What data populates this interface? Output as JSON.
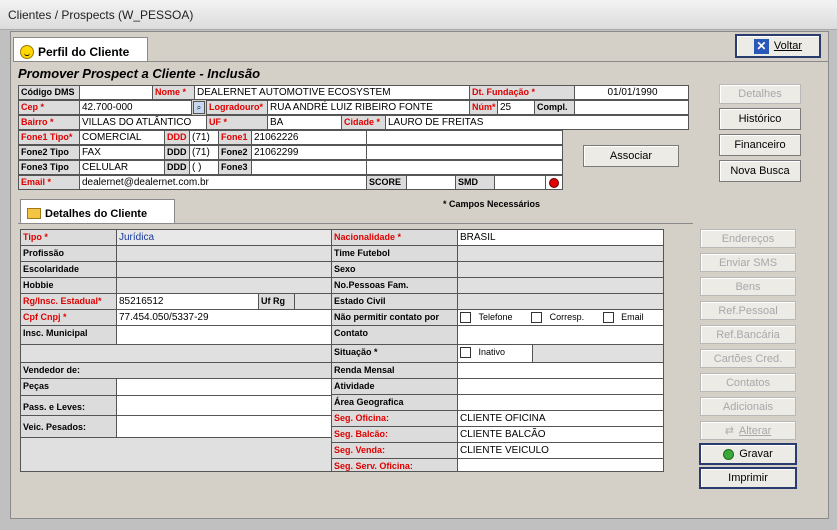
{
  "window": {
    "title": "Clientes / Prospects (W_PESSOA)"
  },
  "tabs": {
    "perfil": "Perfil do Cliente",
    "detalhes": "Detalhes do Cliente"
  },
  "form": {
    "heading": "Promover Prospect a Cliente - Inclusão",
    "required_note": "* Campos Necessários"
  },
  "buttons": {
    "voltar": "Voltar",
    "detalhes": "Detalhes",
    "historico": "Histórico",
    "financeiro": "Financeiro",
    "nova_busca": "Nova Busca",
    "associar": "Associar",
    "enderecos": "Endereços",
    "enviar_sms": "Enviar SMS",
    "bens": "Bens",
    "ref_pessoal": "Ref.Pessoal",
    "ref_bancaria": "Ref.Bancária",
    "cartoes": "Cartões Cred.",
    "contatos": "Contatos",
    "adicionais": "Adicionais",
    "alterar": "Alterar",
    "gravar": "Gravar",
    "imprimir": "Imprimir"
  },
  "header_fields": {
    "codigo_dms_label": "Código DMS",
    "codigo_dms": "",
    "nome_label": "Nome *",
    "nome": "DEALERNET AUTOMOTIVE ECOSYSTEM",
    "dt_fundacao_label": "Dt. Fundação *",
    "dt_fundacao": "01/01/1990",
    "cep_label": "Cep *",
    "cep": "42.700-000",
    "logradouro_label": "Logradouro*",
    "logradouro": "RUA ANDRÉ LUIZ RIBEIRO FONTE",
    "num_label": "Núm*",
    "num": "25",
    "compl_label": "Compl.",
    "compl": "",
    "bairro_label": "Bairro *",
    "bairro": "VILLAS DO ATLÂNTICO",
    "uf_label": "UF *",
    "uf": "BA",
    "cidade_label": "Cidade *",
    "cidade": "LAURO DE FREITAS",
    "fone1_tipo_label": "Fone1 Tipo*",
    "fone1_tipo": "COMERCIAL",
    "ddd1_label": "DDD",
    "ddd1": "(71)",
    "fone1_label": "Fone1",
    "fone1": "21062226",
    "fone2_tipo_label": "Fone2 Tipo",
    "fone2_tipo": "FAX",
    "ddd2_label": "DDD",
    "ddd2": "(71)",
    "fone2_label": "Fone2",
    "fone2": "21062299",
    "fone3_tipo_label": "Fone3 Tipo",
    "fone3_tipo": "CELULAR",
    "ddd3_label": "DDD",
    "ddd3": "(  )",
    "fone3_label": "Fone3",
    "fone3": "",
    "email_label": "Email *",
    "email": "dealernet@dealernet.com.br",
    "score_label": "SCORE",
    "score": "",
    "smd_label": "SMD",
    "smd": ""
  },
  "details_left": {
    "tipo_label": "Tipo *",
    "tipo": "Jurídica",
    "profissao_label": "Profissão",
    "escolaridade_label": "Escolaridade",
    "hobbie_label": "Hobbie",
    "rg_label": "Rg/Insc. Estadual*",
    "rg": "85216512",
    "uf_rg_label": "Uf Rg",
    "uf_rg": "",
    "cpf_label": "Cpf Cnpj *",
    "cpf": "77.454.050/5337-29",
    "insc_municipal_label": "Insc. Municipal",
    "insc_municipal": "",
    "vendedor_label": "Vendedor de:",
    "pecas_label": "Peças",
    "pass_leves_label": "Pass. e Leves:",
    "veic_pesados_label": "Veic. Pesados:"
  },
  "details_right": {
    "nacionalidade_label": "Nacionalidade *",
    "nacionalidade": "BRASIL",
    "time_label": "Time Futebol",
    "sexo_label": "Sexo",
    "no_pessoas_label": "No.Pessoas Fam.",
    "estado_civil_label": "Estado Civil",
    "nao_permitir_label": "Não permitir contato por",
    "opt_telefone": "Telefone",
    "opt_corresp": "Corresp.",
    "opt_email": "Email",
    "contato_label": "Contato",
    "situacao_label": "Situação *",
    "situacao_opt": "Inativo",
    "renda_label": "Renda Mensal",
    "atividade_label": "Atividade",
    "area_label": "Área Geografica",
    "seg_oficina_label": "Seg. Oficina:",
    "seg_oficina": "CLIENTE OFICINA",
    "seg_balcao_label": "Seg. Balcão:",
    "seg_balcao": "CLIENTE BALCÃO",
    "seg_venda_label": "Seg. Venda:",
    "seg_venda": "CLIENTE VEICULO",
    "seg_serv_label": "Seg. Serv. Oficina:",
    "seg_serv": ""
  }
}
